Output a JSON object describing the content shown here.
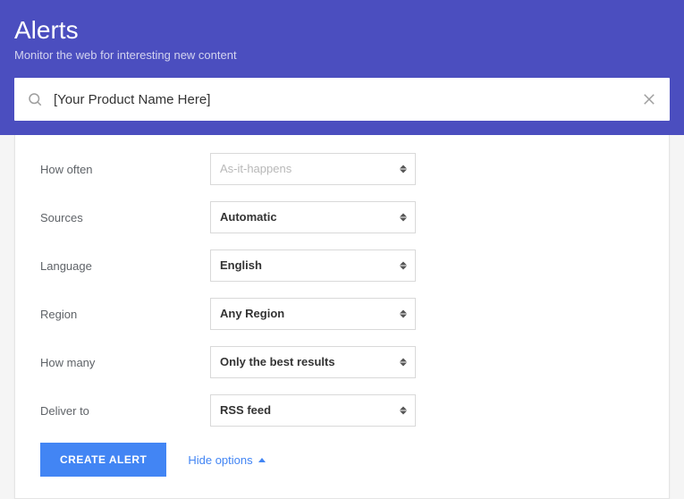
{
  "header": {
    "title": "Alerts",
    "subtitle": "Monitor the web for interesting new content"
  },
  "search": {
    "value": "[Your Product Name Here]"
  },
  "options": {
    "how_often": {
      "label": "How often",
      "value": "As-it-happens",
      "muted": true
    },
    "sources": {
      "label": "Sources",
      "value": "Automatic"
    },
    "language": {
      "label": "Language",
      "value": "English"
    },
    "region": {
      "label": "Region",
      "value": "Any Region"
    },
    "how_many": {
      "label": "How many",
      "value": "Only the best results"
    },
    "deliver_to": {
      "label": "Deliver to",
      "value": "RSS feed"
    }
  },
  "actions": {
    "create_label": "CREATE ALERT",
    "hide_label": "Hide options"
  }
}
